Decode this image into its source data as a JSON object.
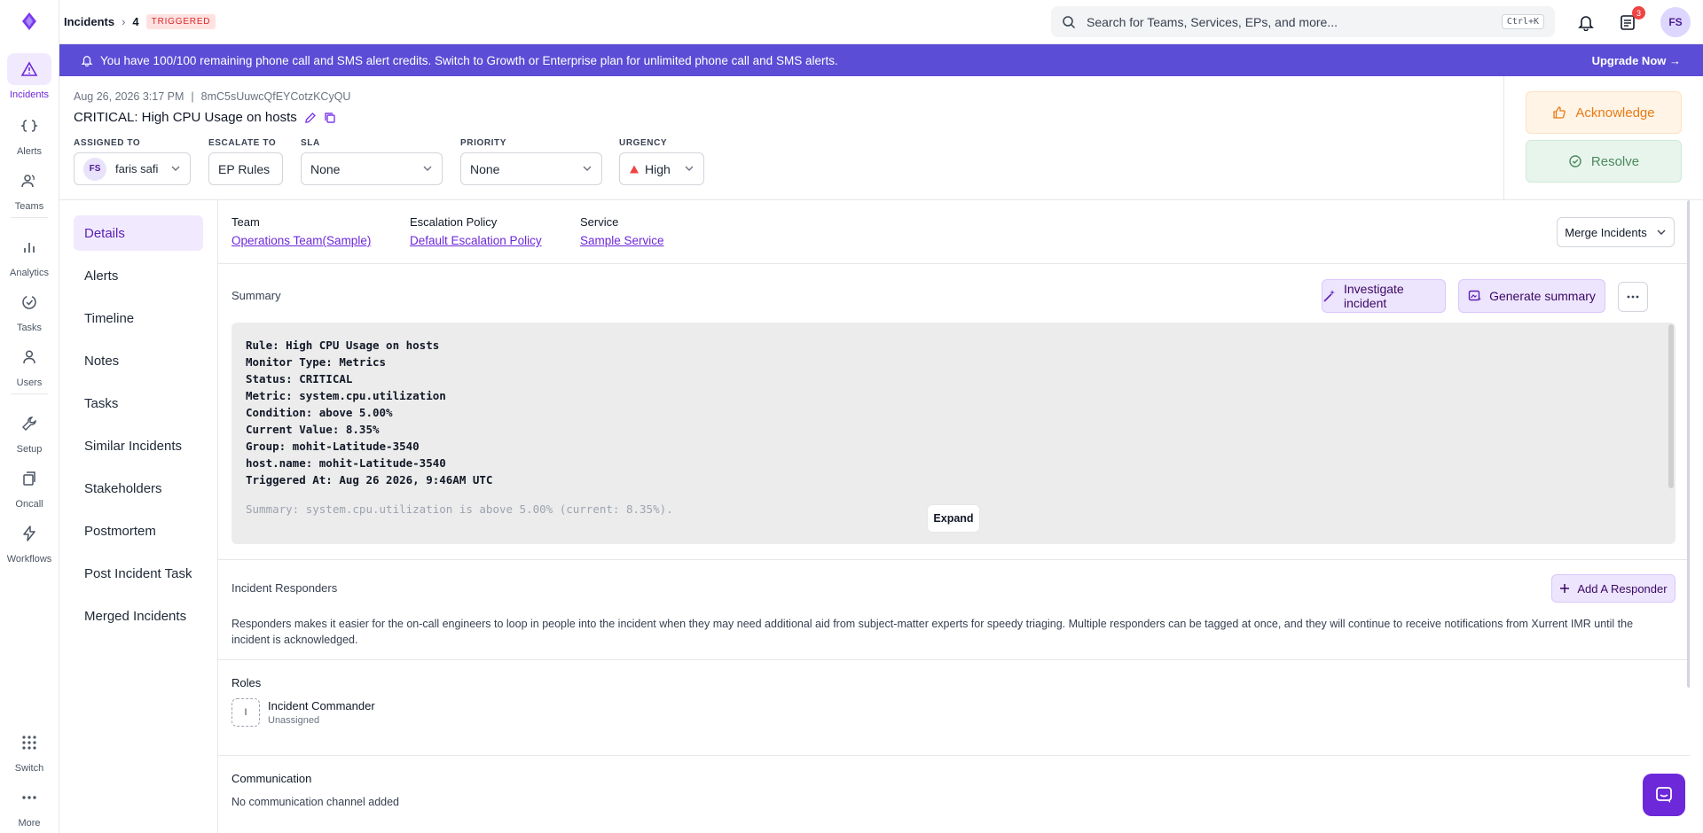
{
  "rail": {
    "items": [
      {
        "label": "Incidents",
        "icon": "warning-triangle-icon"
      },
      {
        "label": "Alerts",
        "icon": "braces-icon"
      },
      {
        "label": "Teams",
        "icon": "team-icon"
      },
      {
        "label": "Analytics",
        "icon": "bar-chart-icon"
      },
      {
        "label": "Tasks",
        "icon": "task-check-icon"
      },
      {
        "label": "Users",
        "icon": "user-icon"
      },
      {
        "label": "Setup",
        "icon": "wrench-icon"
      },
      {
        "label": "Oncall",
        "icon": "oncall-icon"
      },
      {
        "label": "Workflows",
        "icon": "bolt-icon"
      },
      {
        "label": "Switch",
        "icon": "grid-icon"
      },
      {
        "label": "More",
        "icon": "dots-icon"
      }
    ]
  },
  "topbar": {
    "breadcrumb_root": "Incidents",
    "breadcrumb_num": "4",
    "status_badge": "TRIGGERED",
    "search_placeholder": "Search for Teams, Services, EPs, and more...",
    "search_shortcut": "Ctrl+K",
    "notif_count": "3",
    "avatar_initials": "FS"
  },
  "banner": {
    "text": "You have 100/100 remaining phone call and SMS alert credits. Switch to Growth or Enterprise plan for unlimited phone call and SMS alerts.",
    "cta": "Upgrade Now →"
  },
  "incident": {
    "timestamp": "Aug 26, 2026 3:17 PM",
    "separator": "|",
    "id": "8mC5sUuwcQfEYCotzKCyQU",
    "title": "CRITICAL: High CPU Usage on hosts",
    "assigned_label": "ASSIGNED TO",
    "assigned_initials": "FS",
    "assigned_name": "faris safi",
    "escalate_label": "ESCALATE TO",
    "escalate_value": "EP Rules",
    "sla_label": "SLA",
    "sla_value": "None",
    "priority_label": "PRIORITY",
    "priority_value": "None",
    "urgency_label": "URGENCY",
    "urgency_value": "High",
    "ack_label": "Acknowledge",
    "resolve_label": "Resolve"
  },
  "leftnav": {
    "items": [
      "Details",
      "Alerts",
      "Timeline",
      "Notes",
      "Tasks",
      "Similar Incidents",
      "Stakeholders",
      "Postmortem",
      "Post Incident Task",
      "Merged Incidents"
    ]
  },
  "details": {
    "team_label": "Team",
    "team_value": "Operations Team(Sample)",
    "ep_label": "Escalation Policy",
    "ep_value": "Default Escalation Policy",
    "service_label": "Service",
    "service_value": "Sample Service",
    "merge_label": "Merge Incidents",
    "summary_label": "Summary",
    "investigate_label": "Investigate incident",
    "generate_label": "Generate summary",
    "summary_lines": [
      "Rule: High CPU Usage on hosts",
      "Monitor Type: Metrics",
      "Status: CRITICAL",
      "Metric: system.cpu.utilization",
      "Condition: above 5.00%",
      "Current Value: 8.35%",
      "Group: mohit-Latitude-3540",
      "host.name: mohit-Latitude-3540",
      "Triggered At: Aug 26 2026, 9:46AM UTC"
    ],
    "summary_tail": "Summary: system.cpu.utilization is above 5.00% (current: 8.35%).",
    "expand_label": "Expand",
    "responders_label": "Incident Responders",
    "add_responder_label": "Add A Responder",
    "responders_text": "Responders makes it easier for the on-call engineers to loop in people into the incident when they may need additional aid from subject-matter experts for speedy triaging. Multiple responders can be tagged at once, and they will continue to receive notifications from Xurrent IMR until the incident is acknowledged.",
    "roles_label": "Roles",
    "role_initial": "I",
    "role_name": "Incident Commander",
    "role_status": "Unassigned",
    "comm_label": "Communication",
    "comm_text": "No communication channel added"
  },
  "colors": {
    "accent": "#6d28d9",
    "banner": "#5b4dd6",
    "ack": "#ea7a16",
    "resolve": "#4b8a5e",
    "triggered": "#dc2626"
  }
}
